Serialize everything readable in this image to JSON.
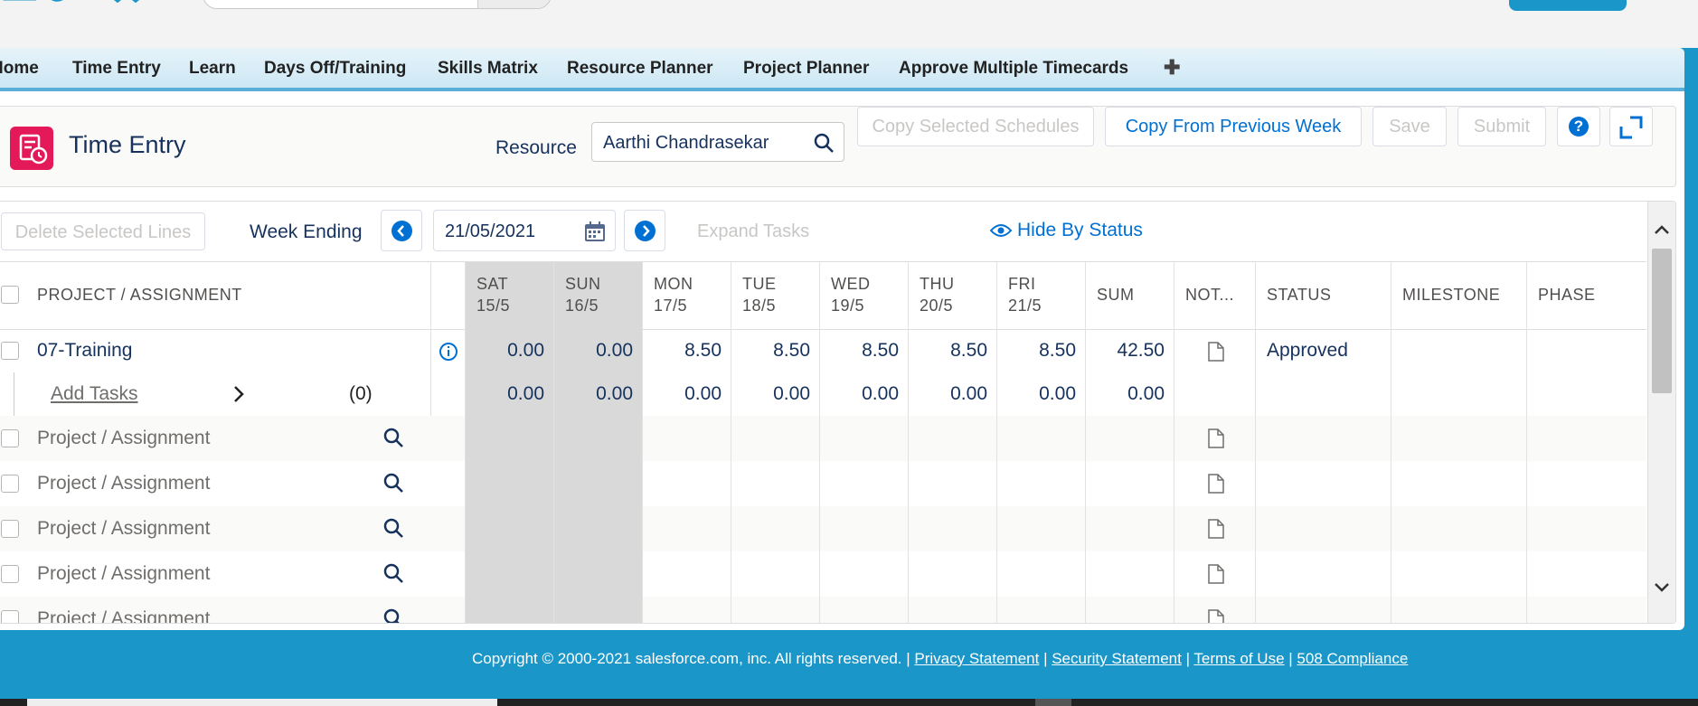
{
  "nav": {
    "tabs": [
      "Home",
      "Time Entry",
      "Learn",
      "Days Off/Training",
      "Skills Matrix",
      "Resource Planner",
      "Project Planner",
      "Approve Multiple Timecards"
    ],
    "add_tab": "✚"
  },
  "header": {
    "title": "Time Entry",
    "resource_label": "Resource",
    "resource_value": "Aarthi Chandrasekar",
    "copy_selected": "Copy Selected Schedules",
    "copy_previous": "Copy From Previous Week",
    "save": "Save",
    "submit": "Submit",
    "help": "?"
  },
  "toolbar": {
    "delete_lines": "Delete Selected Lines",
    "week_ending_label": "Week Ending",
    "week_ending_value": "21/05/2021",
    "expand_tasks": "Expand Tasks",
    "hide_by_status": "Hide By Status"
  },
  "table": {
    "columns": {
      "project": "PROJECT / ASSIGNMENT",
      "days": [
        {
          "d": "SAT",
          "date": "15/5"
        },
        {
          "d": "SUN",
          "date": "16/5"
        },
        {
          "d": "MON",
          "date": "17/5"
        },
        {
          "d": "TUE",
          "date": "18/5"
        },
        {
          "d": "WED",
          "date": "19/5"
        },
        {
          "d": "THU",
          "date": "20/5"
        },
        {
          "d": "FRI",
          "date": "21/5"
        }
      ],
      "sum": "SUM",
      "notes": "NOT...",
      "status": "STATUS",
      "milestone": "MILESTONE",
      "phase": "PHASE"
    },
    "assignment": {
      "name": "07-Training",
      "hours": [
        "0.00",
        "0.00",
        "8.50",
        "8.50",
        "8.50",
        "8.50",
        "8.50"
      ],
      "sum": "42.50",
      "status": "Approved"
    },
    "task_row": {
      "label": "Add Tasks",
      "count": "(0)",
      "hours": [
        "0.00",
        "0.00",
        "0.00",
        "0.00",
        "0.00",
        "0.00",
        "0.00"
      ],
      "sum": "0.00"
    },
    "placeholder": "Project / Assignment"
  },
  "footer": {
    "copyright": "Copyright © 2000-2021 salesforce.com, inc. All rights reserved. | ",
    "privacy": "Privacy Statement",
    "security": "Security Statement",
    "terms": "Terms of Use",
    "compliance": "508 Compliance",
    "sep": " | "
  }
}
